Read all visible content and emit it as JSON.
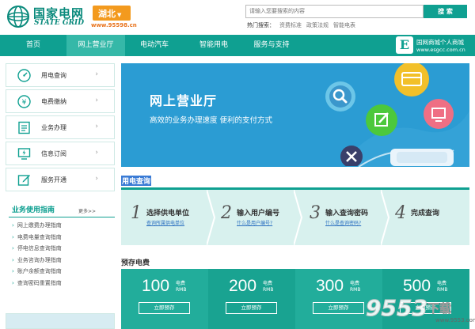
{
  "header": {
    "logo_cn": "国家电网",
    "logo_en": "STATE GRID",
    "region": "湖北",
    "region_url": "www.95598.cn",
    "search_placeholder": "请输入您要搜索的内容",
    "search_button": "搜 索",
    "hot_label": "热门搜索：",
    "hot_items": [
      "资费标准",
      "政策法规",
      "智能电表"
    ]
  },
  "nav": {
    "items": [
      "首页",
      "网上营业厅",
      "电动汽车",
      "智能用电",
      "服务与支持"
    ],
    "active": "网上营业厅",
    "mall_title": "国网商城个人商城",
    "mall_url": "www.esgcc.com.cn",
    "mall_badge": "E"
  },
  "sidebar": {
    "items": [
      {
        "label": "用电查询",
        "icon": "gauge-icon"
      },
      {
        "label": "电费缴纳",
        "icon": "yen-coin-icon"
      },
      {
        "label": "业务办理",
        "icon": "document-list-icon"
      },
      {
        "label": "信息订阅",
        "icon": "monitor-bolt-icon"
      },
      {
        "label": "服务开通",
        "icon": "edit-icon"
      }
    ],
    "arrow": "›"
  },
  "guide": {
    "title": "业务使用指南",
    "more": "更多>>",
    "items": [
      "网上缴费办理指南",
      "电费电量查询指南",
      "停电信息查询指南",
      "业务咨询办理指南",
      "账户余额查询指南",
      "查询密码重置指南"
    ]
  },
  "banner": {
    "title": "网上营业厅",
    "subtitle": "高效的业务办理速度  便利的支付方式"
  },
  "query": {
    "section_title": "用电查询",
    "steps": [
      {
        "num": "1",
        "title": "选择供电单位",
        "link": "查询所属供电单位"
      },
      {
        "num": "2",
        "title": "输入用户编号",
        "link": "什么是用户编号?"
      },
      {
        "num": "3",
        "title": "输入查询密码",
        "link": "什么是查询密码?"
      },
      {
        "num": "4",
        "title": "完成查询",
        "link": ""
      }
    ]
  },
  "prepay": {
    "section_title": "预存电费",
    "items": [
      {
        "amount": "100",
        "unit1": "电费",
        "unit2": "RMB",
        "button": "立即预存"
      },
      {
        "amount": "200",
        "unit1": "电费",
        "unit2": "RMB",
        "button": "立即预存"
      },
      {
        "amount": "300",
        "unit1": "电费",
        "unit2": "RMB",
        "button": "立即预存"
      },
      {
        "amount": "500",
        "unit1": "电费",
        "unit2": "RMB",
        "button": "立即预存"
      }
    ]
  },
  "watermark": {
    "text": "9553",
    "text2": "下载",
    "url": "www.9553.com"
  },
  "colors": {
    "brand": "#0fa091",
    "banner": "#2b9cd3",
    "region": "#f39a1e"
  }
}
